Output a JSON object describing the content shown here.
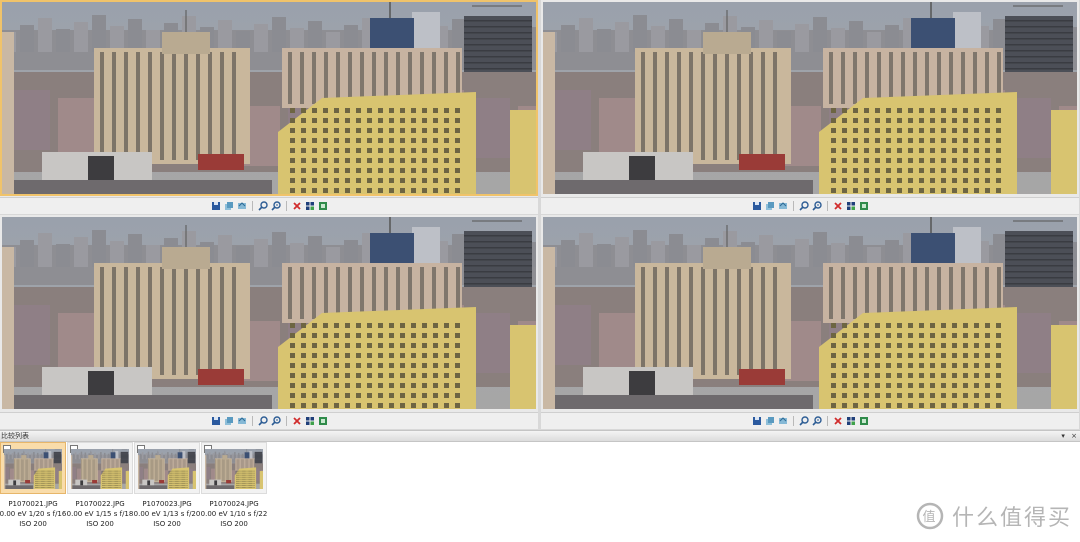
{
  "compare_grid": {
    "panes": [
      {
        "name": "pane-1",
        "selected": true
      },
      {
        "name": "pane-2",
        "selected": false
      },
      {
        "name": "pane-3",
        "selected": false
      },
      {
        "name": "pane-4",
        "selected": false
      }
    ],
    "toolbar_icons": [
      "save-icon",
      "copy-icon",
      "refresh-icon",
      "zoom-in-icon",
      "zoom-out-icon",
      "delete-icon",
      "grid-icon",
      "export-icon"
    ]
  },
  "compare_list": {
    "title": "比较列表",
    "pin_glyph": "▾",
    "close_glyph": "×"
  },
  "thumbnails": [
    {
      "filename": "P1070021.JPG",
      "exposure": "0.00 eV 1/20 s f/16",
      "iso": "ISO 200",
      "selected": true
    },
    {
      "filename": "P1070022.JPG",
      "exposure": "0.00 eV 1/15 s f/18",
      "iso": "ISO 200",
      "selected": false
    },
    {
      "filename": "P1070023.JPG",
      "exposure": "0.00 eV 1/13 s f/20",
      "iso": "ISO 200",
      "selected": false
    },
    {
      "filename": "P1070024.JPG",
      "exposure": "0.00 eV 1/10 s f/22",
      "iso": "ISO 200",
      "selected": false
    }
  ],
  "watermark": {
    "text": "什么值得买",
    "logo_glyph": "值"
  },
  "colors": {
    "selection": "#f0c36a",
    "sky": "#8f98a6",
    "yellow_building": "#d8c470"
  }
}
